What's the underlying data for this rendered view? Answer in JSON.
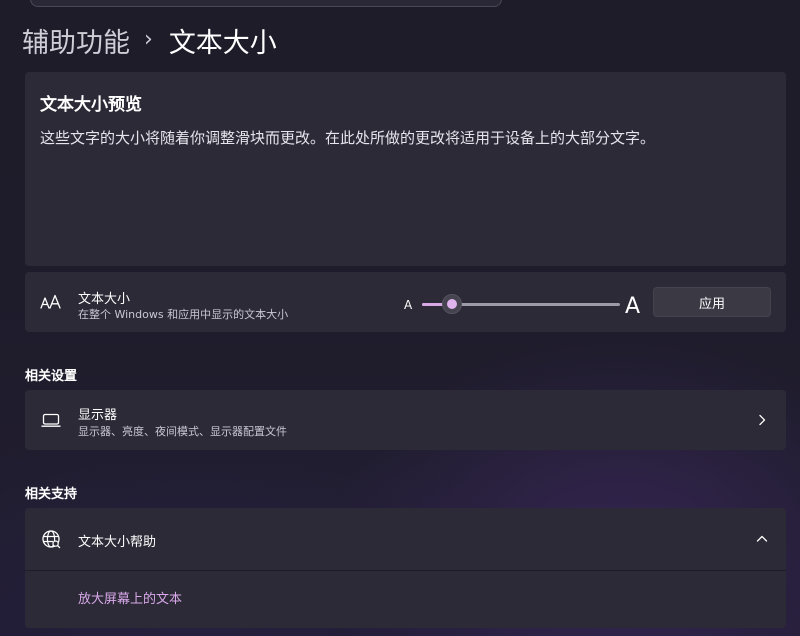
{
  "breadcrumb": {
    "parent": "辅助功能",
    "separator": "›",
    "current": "文本大小"
  },
  "preview": {
    "title": "文本大小预览",
    "text": "这些文字的大小将随着你调整滑块而更改。在此处所做的更改将适用于设备上的大部分文字。"
  },
  "text_size": {
    "icon": "text-size-icon",
    "title": "文本大小",
    "subtitle": "在整个 Windows 和应用中显示的文本大小",
    "slider_min_label": "A",
    "slider_max_label": "A",
    "slider_value_fraction": 0.15,
    "apply_label": "应用"
  },
  "related_settings": {
    "heading": "相关设置",
    "items": [
      {
        "icon": "monitor-icon",
        "title": "显示器",
        "subtitle": "显示器、亮度、夜间模式、显示器配置文件"
      }
    ]
  },
  "related_support": {
    "heading": "相关支持",
    "help": {
      "icon": "globe-icon",
      "title": "文本大小帮助",
      "expanded": true,
      "links": [
        "放大屏幕上的文本"
      ]
    }
  },
  "colors": {
    "accent": "#d9a8ea",
    "card": "#2b2a36",
    "background": "#1f1d2b"
  }
}
